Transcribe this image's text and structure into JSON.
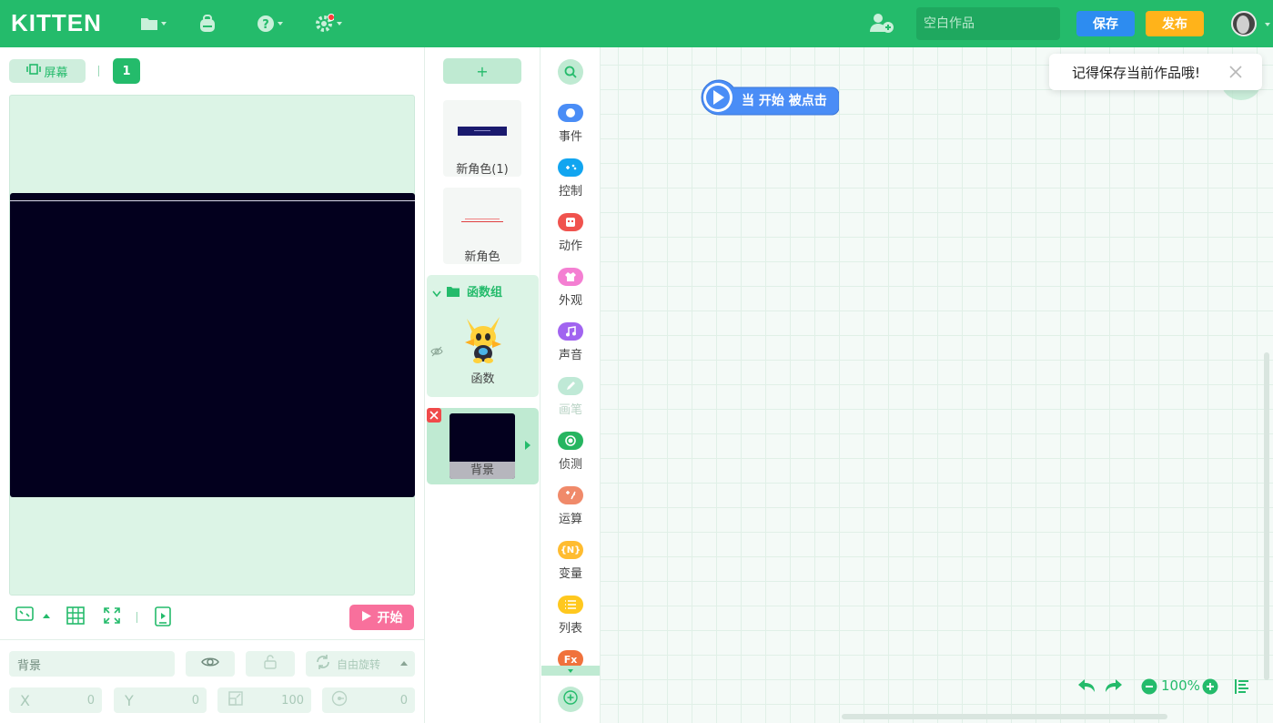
{
  "topbar": {
    "logo": "KITTEN",
    "title_placeholder": "空白作品",
    "save_label": "保存",
    "publish_label": "发布",
    "colors": {
      "brand": "#24bb6b",
      "save": "#2d8cf0",
      "publish": "#ffb31a"
    }
  },
  "stage": {
    "screen_label": "屏幕",
    "page_number": "1",
    "start_label": "开始"
  },
  "props": {
    "name_value": "背景",
    "rotate_label": "自由旋转",
    "x_label": "X",
    "x_value": "0",
    "y_label": "Y",
    "y_value": "0",
    "scale_value": "100",
    "direction_value": "0"
  },
  "sprites": {
    "add_label": "+",
    "items": [
      {
        "label": "新角色(1)"
      },
      {
        "label": "新角色"
      }
    ],
    "group": {
      "label": "函数组",
      "item_label": "函数"
    },
    "background": {
      "label": "背景"
    }
  },
  "categories": [
    {
      "label": "事件",
      "color": "#4a8df6"
    },
    {
      "label": "控制",
      "color": "#11a5f0"
    },
    {
      "label": "动作",
      "color": "#f0534e"
    },
    {
      "label": "外观",
      "color": "#f47fd2"
    },
    {
      "label": "声音",
      "color": "#a164f0"
    },
    {
      "label": "画笔",
      "color": "#bfe9d6"
    },
    {
      "label": "侦测",
      "color": "#26b560"
    },
    {
      "label": "运算",
      "color": "#f08a6a"
    },
    {
      "label": "变量",
      "color": "#ffbc30"
    },
    {
      "label": "列表",
      "color": "#ffc81e"
    },
    {
      "label": "Fx",
      "color": "#f0723c"
    }
  ],
  "workspace": {
    "hat_block_label": "当 开始 被点击",
    "toast_text": "记得保存当前作品哦!",
    "zoom_level": "100%"
  }
}
